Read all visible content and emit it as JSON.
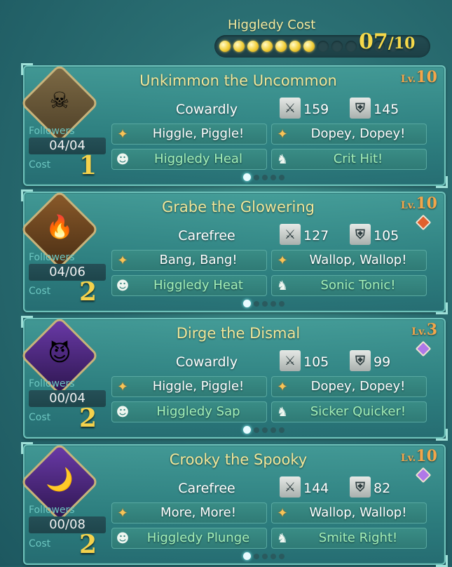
{
  "header": {
    "title": "Higgledy Cost",
    "pips_total": 14,
    "pips_filled": 7,
    "count_current": "07",
    "count_sep_max": "/10"
  },
  "cards": [
    {
      "name": "Unkimmon the Uncommon",
      "level_prefix": "Lv.",
      "level": "10",
      "badge_color": "",
      "emblem_icon": "skull-mask-icon",
      "emblem_glyph": "☠",
      "emblem_colors": [
        "#7d6a45",
        "#4e4028"
      ],
      "trait": "Cowardly",
      "attack": "159",
      "defense": "145",
      "followers_label": "Followers",
      "followers": "04/04",
      "cost_label": "Cost",
      "cost": "1",
      "skills": [
        {
          "label": "Higgle, Piggle!",
          "icon": "compass-star-icon",
          "kind": "orange"
        },
        {
          "label": "Dopey, Dopey!",
          "icon": "compass-star-icon",
          "kind": "orange"
        },
        {
          "label": "Higgledy Heal",
          "icon": "higgledy-icon",
          "kind": "green"
        },
        {
          "label": "Crit Hit!",
          "icon": "horned-mask-icon",
          "kind": "green"
        }
      ]
    },
    {
      "name": "Grabe the Glowering",
      "level_prefix": "Lv.",
      "level": "10",
      "badge_color": "#e0602e",
      "emblem_icon": "flame-mask-icon",
      "emblem_glyph": "🔥",
      "emblem_colors": [
        "#8a5a2a",
        "#4a2e14"
      ],
      "trait": "Carefree",
      "attack": "127",
      "defense": "105",
      "followers_label": "Followers",
      "followers": "04/06",
      "cost_label": "Cost",
      "cost": "2",
      "skills": [
        {
          "label": "Bang, Bang!",
          "icon": "compass-star-icon",
          "kind": "orange"
        },
        {
          "label": "Wallop, Wallop!",
          "icon": "compass-star-icon",
          "kind": "orange"
        },
        {
          "label": "Higgledy Heat",
          "icon": "higgledy-icon",
          "kind": "green"
        },
        {
          "label": "Sonic Tonic!",
          "icon": "horned-mask-icon",
          "kind": "green"
        }
      ]
    },
    {
      "name": "Dirge the Dismal",
      "level_prefix": "Lv.",
      "level": "3",
      "badge_color": "#b078e8",
      "emblem_icon": "horned-demon-icon",
      "emblem_glyph": "😈",
      "emblem_colors": [
        "#6a3aa8",
        "#2e1650"
      ],
      "trait": "Cowardly",
      "attack": "105",
      "defense": "99",
      "followers_label": "Followers",
      "followers": "00/04",
      "cost_label": "Cost",
      "cost": "2",
      "skills": [
        {
          "label": "Higgle, Piggle!",
          "icon": "compass-star-icon",
          "kind": "orange"
        },
        {
          "label": "Dopey, Dopey!",
          "icon": "compass-star-icon",
          "kind": "orange"
        },
        {
          "label": "Higgledy Sap",
          "icon": "higgledy-icon",
          "kind": "green"
        },
        {
          "label": "Sicker Quicker!",
          "icon": "horned-mask-icon",
          "kind": "green"
        }
      ]
    },
    {
      "name": "Crooky the Spooky",
      "level_prefix": "Lv.",
      "level": "10",
      "badge_color": "#b078e8",
      "emblem_icon": "crescent-moon-icon",
      "emblem_glyph": "🌙",
      "emblem_colors": [
        "#6a3aa8",
        "#2e1650"
      ],
      "trait": "Carefree",
      "attack": "144",
      "defense": "82",
      "followers_label": "Followers",
      "followers": "00/08",
      "cost_label": "Cost",
      "cost": "2",
      "skills": [
        {
          "label": "More, More!",
          "icon": "compass-star-icon",
          "kind": "orange"
        },
        {
          "label": "Wallop, Wallop!",
          "icon": "compass-star-icon",
          "kind": "orange"
        },
        {
          "label": "Higgledy Plunge",
          "icon": "higgledy-icon",
          "kind": "green"
        },
        {
          "label": "Smite Right!",
          "icon": "horned-mask-icon",
          "kind": "green"
        }
      ]
    }
  ]
}
